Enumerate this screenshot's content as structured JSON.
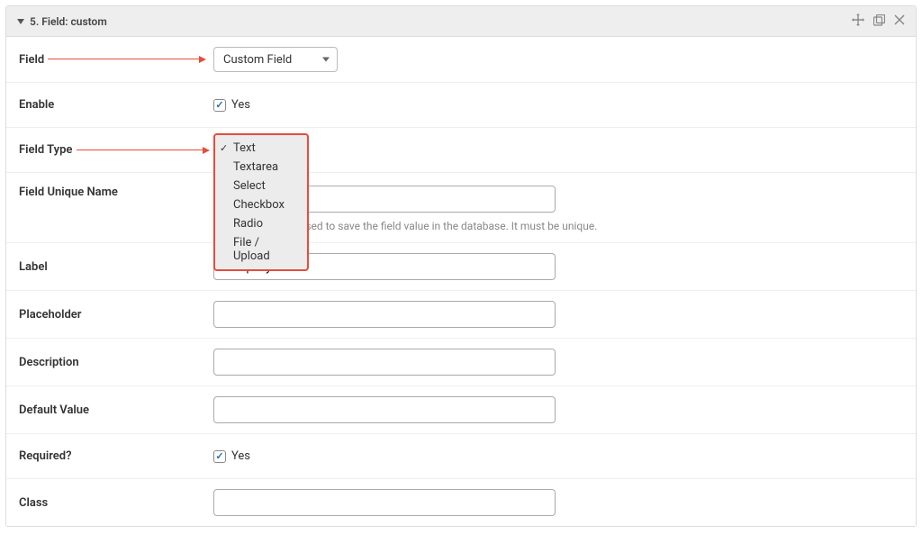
{
  "header": {
    "title": "5. Field:  custom"
  },
  "annotations": {
    "arrow_color": "#e74c3c"
  },
  "rows": {
    "field": {
      "label": "Field",
      "select_value": "Custom Field"
    },
    "enable": {
      "label": "Enable",
      "checkbox_label": "Yes",
      "checked": true
    },
    "field_type": {
      "label": "Field Type",
      "options": [
        "Text",
        "Textarea",
        "Select",
        "Checkbox",
        "Radio",
        "File / Upload"
      ],
      "selected": "Text"
    },
    "unique_name": {
      "label": "Field Unique Name",
      "value": "",
      "help": "This name will be used to save the field value in the database. It must be unique."
    },
    "label_field": {
      "label": "Label",
      "value": "Company Name"
    },
    "placeholder": {
      "label": "Placeholder",
      "value": ""
    },
    "description": {
      "label": "Description",
      "value": ""
    },
    "default_value": {
      "label": "Default Value",
      "value": ""
    },
    "required": {
      "label": "Required?",
      "checkbox_label": "Yes",
      "checked": true
    },
    "class": {
      "label": "Class",
      "value": ""
    }
  }
}
